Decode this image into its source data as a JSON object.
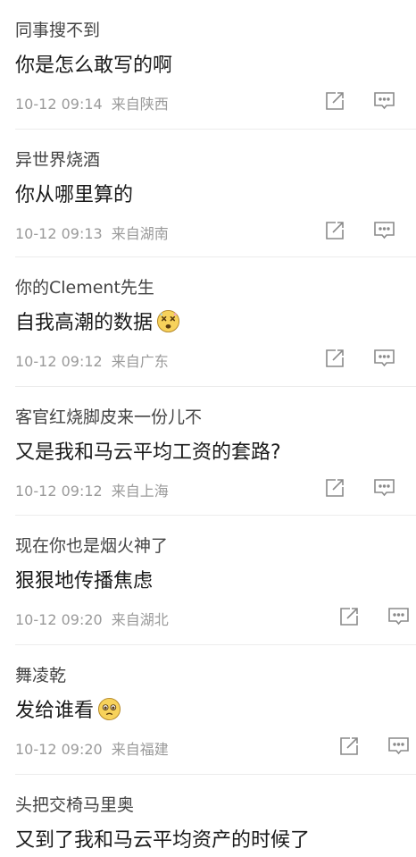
{
  "comments": [
    {
      "user": "同事搜不到",
      "text": "你是怎么敢写的啊",
      "emoji": "",
      "time": "10-12 09:14",
      "location": "来自陕西"
    },
    {
      "user": "异世界烧酒",
      "text": "你从哪里算的",
      "emoji": "",
      "time": "10-12 09:13",
      "location": "来自湖南"
    },
    {
      "user": "你的Clement先生",
      "text": "自我高潮的数据",
      "emoji": "dizzy-face-emoji",
      "time": "10-12 09:12",
      "location": "来自广东"
    },
    {
      "user": "客官红烧脚皮来一份儿不",
      "text": "又是我和马云平均工资的套路?",
      "emoji": "",
      "time": "10-12 09:12",
      "location": "来自上海"
    },
    {
      "user": "现在你也是烟火神了",
      "text": "狠狠地传播焦虑",
      "emoji": "",
      "time": "10-12 09:20",
      "location": "来自湖北"
    },
    {
      "user": "舞凌乾",
      "text": "发给谁看",
      "emoji": "pleading-face-emoji",
      "time": "10-12 09:20",
      "location": "来自福建"
    },
    {
      "user": "头把交椅马里奥",
      "text": "又到了我和马云平均资产的时候了",
      "emoji": "",
      "time": "",
      "location": ""
    }
  ],
  "icons": {
    "share": "share-icon",
    "reply": "comment-icon"
  },
  "colors": {
    "text": "#1a1a1a",
    "username": "#444444",
    "meta": "#9a9a9a",
    "icon": "#8a8a8a",
    "divider": "#ececec",
    "emoji": "#f7d25b"
  }
}
